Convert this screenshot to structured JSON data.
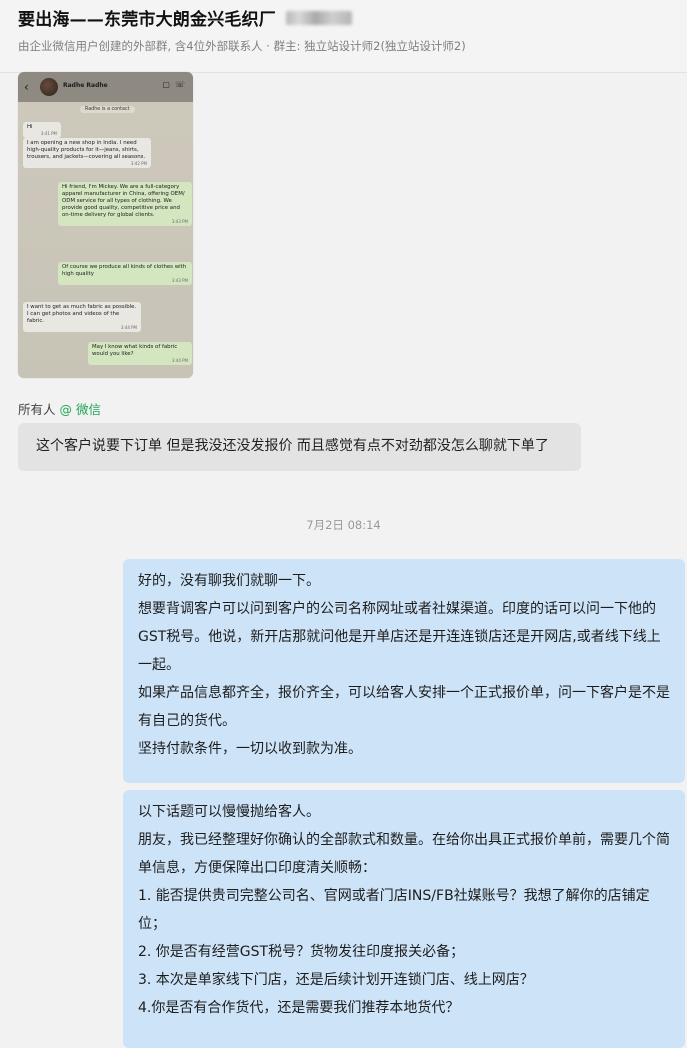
{
  "header": {
    "title": "要出海——东莞市大朗金兴毛织厂",
    "subtitle": "由企业微信用户创建的外部群, 含4位外部联系人 · 群主: 独立站设计师2(独立站设计师2)"
  },
  "shared_screenshot": {
    "contact_name": "Radhe Radhe",
    "contact_notice": "Radhe is a contact",
    "icons": [
      "back-arrow-icon",
      "video-call-icon",
      "phone-icon"
    ],
    "messages": [
      {
        "dir": "in",
        "text": "Hi",
        "time": "3:41 PM"
      },
      {
        "dir": "in",
        "text": "I am opening a new shop in India. I need high-quality products for it—jeans, shirts, trousers, and jackets—covering all seasons.",
        "time": "3:42 PM"
      },
      {
        "dir": "out",
        "text": "Hi friend, I'm Mickey. We are a full-category apparel manufacturer in China, offering OEM/ ODM service for all types of clothing. We provide good quality, competitive price and on-time delivery for global clients.",
        "time": "3:43 PM"
      },
      {
        "dir": "out",
        "text": "Of course we produce all kinds of clothes with high quality",
        "time": "3:43 PM"
      },
      {
        "dir": "in",
        "text": "I want to get as much fabric as possible. I can get photos and videos of the fabric.",
        "time": "3:44 PM"
      },
      {
        "dir": "out",
        "text": "May I know what kinds of fabric would you like?",
        "time": "3:44 PM"
      }
    ]
  },
  "mention": {
    "prefix": "所有人",
    "at": "@ 微信"
  },
  "messages": {
    "gray": "这个客户说要下订单 但是我没还没发报价  而且感觉有点不对劲都没怎么聊就下单了",
    "timestamp": "7月2日 08:14",
    "blue1": [
      "好的，没有聊我们就聊一下。",
      "想要背调客户可以问到客户的公司名称网址或者社媒渠道。印度的话可以问一下他的GST税号。他说，新开店那就问他是开单店还是开连连锁店还是开网店,或者线下线上一起。",
      "如果产品信息都齐全，报价齐全，可以给客人安排一个正式报价单，问一下客户是不是有自己的货代。",
      "坚持付款条件，一切以收到款为准。"
    ],
    "blue2": [
      "以下话题可以慢慢抛给客人。",
      "朋友，我已经整理好你确认的全部款式和数量。在给你出具正式报价单前，需要几个简单信息，方便保障出口印度清关顺畅：",
      "1. 能否提供贵司完整公司名、官网或者门店INS/FB社媒账号？我想了解你的店铺定位；",
      "2. 你是否有经营GST税号？货物发往印度报关必备；",
      "3. 本次是单家线下门店，还是后续计划开连锁门店、线上网店？",
      "4.你是否有合作货代，还是需要我们推荐本地货代？"
    ]
  }
}
